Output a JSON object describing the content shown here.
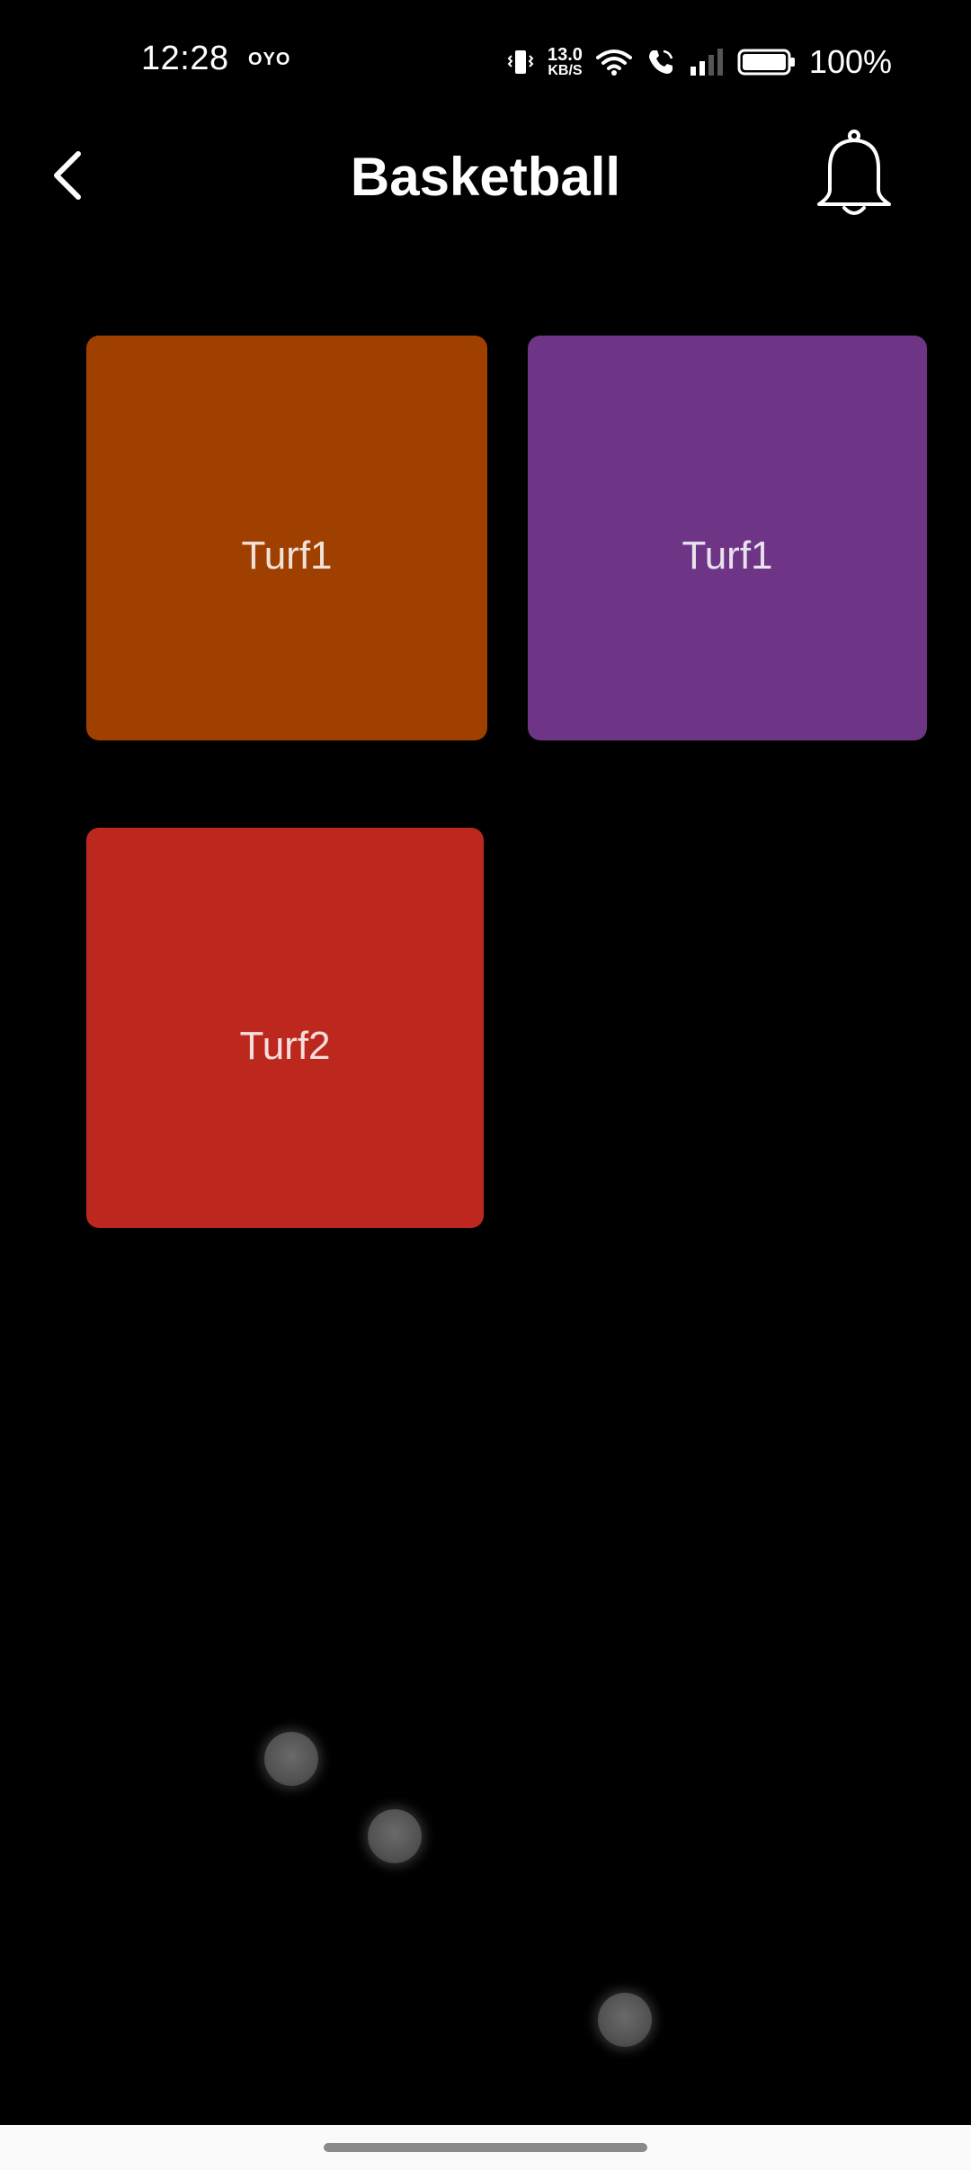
{
  "status_bar": {
    "time": "12:28",
    "app_icon": "OYO",
    "net_speed_value": "13.0",
    "net_speed_unit": "KB/S",
    "battery_percent": "100%"
  },
  "header": {
    "title": "Basketball",
    "back_icon": "chevron-left-icon",
    "bell_icon": "bell-icon"
  },
  "tiles": [
    {
      "label": "Turf1",
      "color": "#A04000"
    },
    {
      "label": "Turf1",
      "color": "#6E3587"
    },
    {
      "label": "Turf2",
      "color": "#BD281E"
    }
  ],
  "colors": {
    "background": "#000000",
    "text": "#FFFFFF"
  }
}
